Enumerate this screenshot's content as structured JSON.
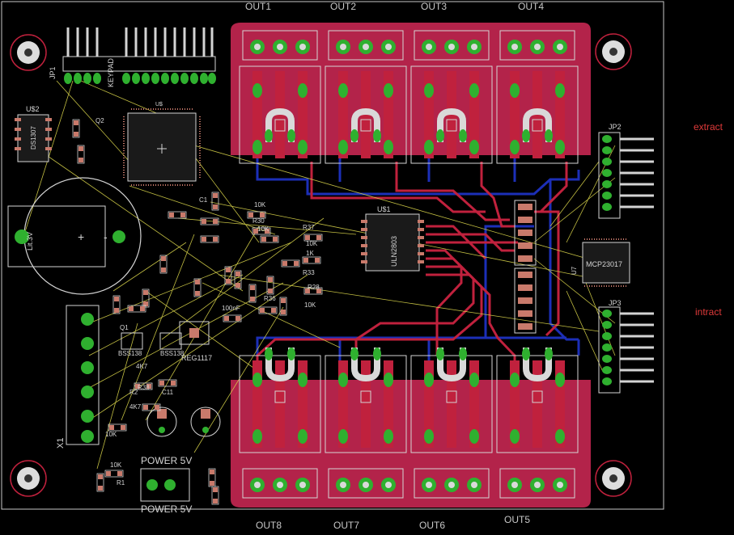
{
  "colors": {
    "background": "#000000",
    "board_outline": "#c8c8c8",
    "top_copper": "#c0213d",
    "relay_pour": "#b3234a",
    "bottom_copper": "#1c2fb8",
    "pad": "#2fb02f",
    "pad_hole": "#d9d9d9",
    "silkscreen": "#d4d4d4",
    "airwire": "#d8d34a",
    "component_body": "#c97a6b",
    "side_label": "#e03a3a"
  },
  "outputs_top": [
    "OUT1",
    "OUT2",
    "OUT3",
    "OUT4"
  ],
  "outputs_bottom": [
    "OUT8",
    "OUT7",
    "OUT6",
    "OUT5"
  ],
  "side_labels": {
    "extract": "extract",
    "intract": "intract"
  },
  "headers": {
    "jp1": "JP1",
    "keypad": "KEYPAD",
    "jp2": "JP2",
    "jp3": "JP3",
    "x1": "X1"
  },
  "ics": {
    "u1": "U$1",
    "u1_part": "ULN2803",
    "u2": "U$2",
    "u2_part": "DS1307",
    "u7": "U7",
    "u7_part": "MCP23017",
    "mcu": "U$"
  },
  "battery": {
    "label": "Lit.3V",
    "plus": "+",
    "minus": "-"
  },
  "power": {
    "top": "POWER 5V",
    "bottom": "POWER 5V"
  },
  "passives": [
    "10K",
    "R30",
    "10K",
    "R37",
    "10K",
    "1K",
    "R33",
    "R28",
    "10K",
    "4K7",
    "R38",
    "R2",
    "10K",
    "4K7",
    "R1",
    "10K",
    "C1",
    "C11",
    "100nF",
    "BSS138",
    "BSS138",
    "REG1117",
    "Q1",
    "Q2",
    "4K7",
    "R36"
  ]
}
